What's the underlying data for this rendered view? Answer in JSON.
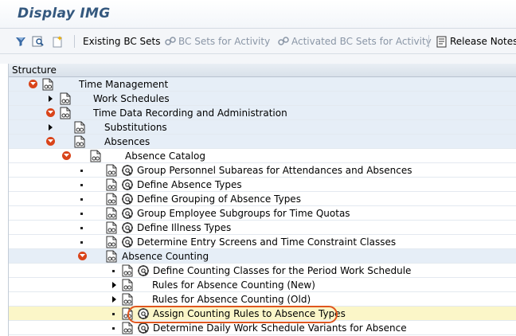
{
  "window": {
    "title": "Display IMG"
  },
  "toolbar": {
    "items": [
      {
        "label": "Existing BC Sets",
        "icon": "bc-sets-icon",
        "enabled": true
      },
      {
        "label": "BC Sets for Activity",
        "icon": "bc-sets-activity-icon",
        "enabled": false
      },
      {
        "label": "Activated BC Sets for Activity",
        "icon": "activated-bc-sets-icon",
        "enabled": false
      },
      {
        "label": "Release Notes",
        "icon": "release-notes-icon",
        "enabled": true
      }
    ]
  },
  "tree": {
    "header": "Structure",
    "nodes": [
      {
        "label": "Time Management",
        "level": 0,
        "state": "expanded",
        "executable": false
      },
      {
        "label": "Work Schedules",
        "level": 1,
        "state": "collapsed",
        "executable": false
      },
      {
        "label": "Time Data Recording and Administration",
        "level": 1,
        "state": "expanded",
        "executable": false
      },
      {
        "label": "Substitutions",
        "level": 2,
        "state": "collapsed",
        "executable": false
      },
      {
        "label": "Absences",
        "level": 2,
        "state": "expanded",
        "executable": false
      },
      {
        "label": "Absence Catalog",
        "level": 3,
        "state": "expanded",
        "executable": false
      },
      {
        "label": "Group Personnel Subareas for Attendances and Absences",
        "level": 4,
        "state": "leaf",
        "executable": true
      },
      {
        "label": "Define Absence Types",
        "level": 4,
        "state": "leaf",
        "executable": true
      },
      {
        "label": "Define Grouping of Absence Types",
        "level": 4,
        "state": "leaf",
        "executable": true
      },
      {
        "label": "Group Employee Subgroups for Time Quotas",
        "level": 4,
        "state": "leaf",
        "executable": true
      },
      {
        "label": "Define Illness Types",
        "level": 4,
        "state": "leaf",
        "executable": true
      },
      {
        "label": "Determine Entry Screens and Time Constraint Classes",
        "level": 4,
        "state": "leaf",
        "executable": true
      },
      {
        "label": "Absence Counting",
        "level": 4,
        "state": "expanded",
        "executable": false
      },
      {
        "label": "Define Counting Classes for the Period Work Schedule",
        "level": 5,
        "state": "leaf",
        "executable": true
      },
      {
        "label": "Rules for Absence Counting (New)",
        "level": 5,
        "state": "collapsed",
        "executable": false
      },
      {
        "label": "Rules for Absence Counting (Old)",
        "level": 5,
        "state": "collapsed",
        "executable": false
      },
      {
        "label": "Assign Counting Rules to Absence Types",
        "level": 5,
        "state": "leaf",
        "executable": true,
        "selected": true
      },
      {
        "label": "Determine Daily Work Schedule Variants for Absence",
        "level": 5,
        "state": "leaf",
        "executable": true
      }
    ]
  },
  "colors": {
    "title": "#34587e",
    "collapse_toggle": "#d9441a",
    "selection": "#fbf6c8",
    "highlight_ring": "#e0561e"
  }
}
